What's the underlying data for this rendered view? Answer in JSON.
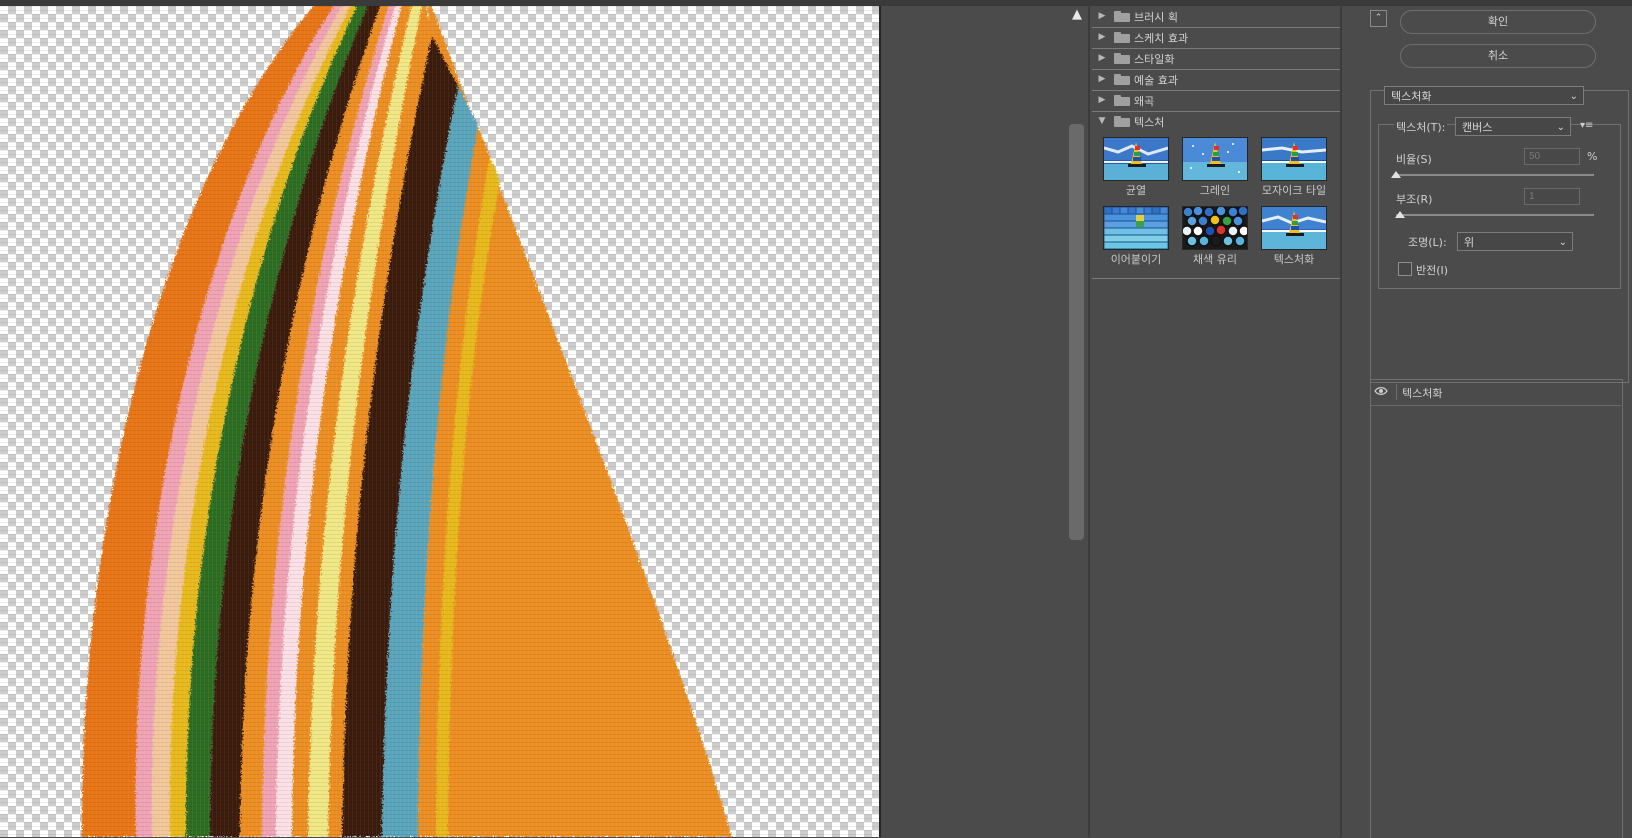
{
  "categories": [
    {
      "label": "브러시 획",
      "expanded": false
    },
    {
      "label": "스케치 효과",
      "expanded": false
    },
    {
      "label": "스타일화",
      "expanded": false
    },
    {
      "label": "예술 효과",
      "expanded": false
    },
    {
      "label": "왜곡",
      "expanded": false
    },
    {
      "label": "텍스처",
      "expanded": true
    }
  ],
  "texture_filters": [
    {
      "label": "균열",
      "icon": "craquelure-thumbnail"
    },
    {
      "label": "그레인",
      "icon": "grain-thumbnail"
    },
    {
      "label": "모자이크 타일",
      "icon": "mosaic-tiles-thumbnail"
    },
    {
      "label": "이어붙이기",
      "icon": "patchwork-thumbnail"
    },
    {
      "label": "채색 유리",
      "icon": "stained-glass-thumbnail"
    },
    {
      "label": "텍스처화",
      "icon": "texturizer-thumbnail",
      "selected": true
    }
  ],
  "buttons": {
    "ok": "확인",
    "cancel": "취소"
  },
  "filter_select": {
    "value": "텍스처화"
  },
  "settings": {
    "texture_label": "텍스처(T):",
    "texture_value": "캔버스",
    "scaling_label": "비율(S)",
    "scaling_value": "50",
    "scaling_unit": "%",
    "scaling_level": 0.0,
    "relief_label": "부조(R)",
    "relief_value": "1",
    "relief_level": 0.02,
    "light_label": "조명(L):",
    "light_value": "위",
    "invert_label": "반전(I)",
    "invert_checked": false
  },
  "effect_layer": {
    "label": "텍스처화",
    "visible": true
  },
  "colors": {
    "panel_bg": "#4b4b4b",
    "stripe_orange": "#ec8e22",
    "stripe_dark_orange": "#e87416",
    "stripe_pink": "#f0a3b4",
    "stripe_peach": "#f3c79c",
    "stripe_gold": "#e8b91d",
    "stripe_green": "#2e6e21",
    "stripe_brown": "#3b1a0e",
    "stripe_light_pink": "#fbe0e6",
    "stripe_yellow": "#f0e785",
    "stripe_blue": "#5aa5bb"
  }
}
